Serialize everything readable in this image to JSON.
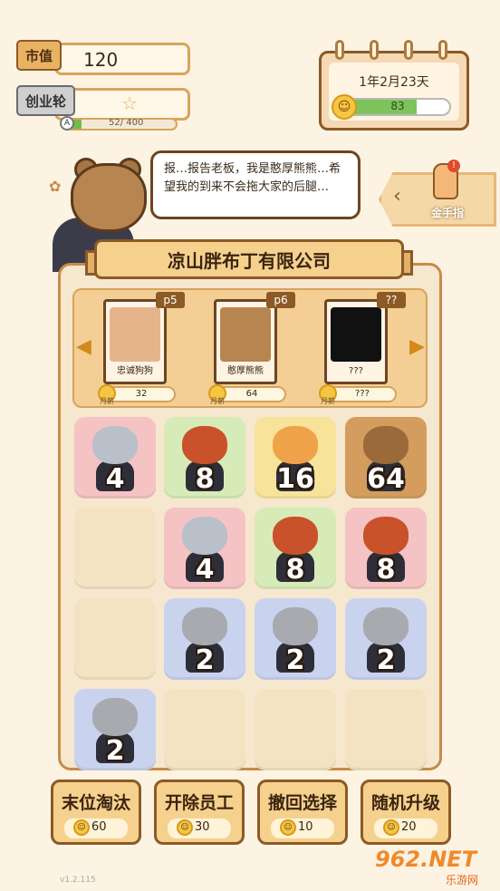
{
  "stats": {
    "market_value_label": "市值",
    "market_value": "120",
    "stage_label": "创业轮",
    "grade": "A",
    "progress_text": "52/ 400",
    "progress_fraction": 0.13
  },
  "calendar": {
    "date": "1年2月23天",
    "mood_value": "83",
    "mood_fraction": 0.68
  },
  "dialogue": {
    "text": "报…报告老板，我是憨厚熊熊…希望我的到来不会拖大家的后腿…"
  },
  "golden_finger": {
    "label": "金手指",
    "alert": "!"
  },
  "company": {
    "name": "凉山胖布丁有限公司"
  },
  "staff_cards": [
    {
      "level": "p5",
      "name": "忠诚狗狗",
      "salary": "32",
      "salary_tag": "月薪",
      "color": "#e6b48a"
    },
    {
      "level": "p6",
      "name": "憨厚熊熊",
      "salary": "64",
      "salary_tag": "月薪",
      "color": "#b7854f"
    },
    {
      "level": "??",
      "name": "???",
      "salary": "???",
      "salary_tag": "月薪",
      "color": "#111111"
    }
  ],
  "grid": [
    {
      "value": "4",
      "animal": "rabbit",
      "bg": "#f5c3c3",
      "head": "#b9c0c9"
    },
    {
      "value": "8",
      "animal": "red-panda",
      "bg": "#d7ebb8",
      "head": "#c9522a"
    },
    {
      "value": "16",
      "animal": "cat",
      "bg": "#f8e39a",
      "head": "#f0a24a"
    },
    {
      "value": "64",
      "animal": "bear",
      "bg": "#d49d5e",
      "head": "#9a6a3a"
    },
    {
      "value": "",
      "animal": "",
      "bg": "",
      "head": ""
    },
    {
      "value": "4",
      "animal": "rabbit",
      "bg": "#f5c3c3",
      "head": "#b9c0c9"
    },
    {
      "value": "8",
      "animal": "red-panda",
      "bg": "#d7ebb8",
      "head": "#c9522a"
    },
    {
      "value": "8",
      "animal": "red-panda",
      "bg": "#f5c3c3",
      "head": "#c9522a"
    },
    {
      "value": "",
      "animal": "",
      "bg": "",
      "head": ""
    },
    {
      "value": "2",
      "animal": "hamster",
      "bg": "#c9d3ee",
      "head": "#a9aab0"
    },
    {
      "value": "2",
      "animal": "hamster",
      "bg": "#c9d3ee",
      "head": "#a9aab0"
    },
    {
      "value": "2",
      "animal": "hamster",
      "bg": "#c9d3ee",
      "head": "#a9aab0"
    },
    {
      "value": "2",
      "animal": "hamster",
      "bg": "#c9d3ee",
      "head": "#a9aab0"
    },
    {
      "value": "",
      "animal": "",
      "bg": "",
      "head": ""
    },
    {
      "value": "",
      "animal": "",
      "bg": "",
      "head": ""
    },
    {
      "value": "",
      "animal": "",
      "bg": "",
      "head": ""
    }
  ],
  "actions": [
    {
      "label": "末位淘汰",
      "cost": "60"
    },
    {
      "label": "开除员工",
      "cost": "30"
    },
    {
      "label": "撤回选择",
      "cost": "10"
    },
    {
      "label": "随机升级",
      "cost": "20"
    }
  ],
  "footer": {
    "version": "v1.2.115",
    "watermark": "962.NET",
    "watermark_sub": "乐游网"
  }
}
